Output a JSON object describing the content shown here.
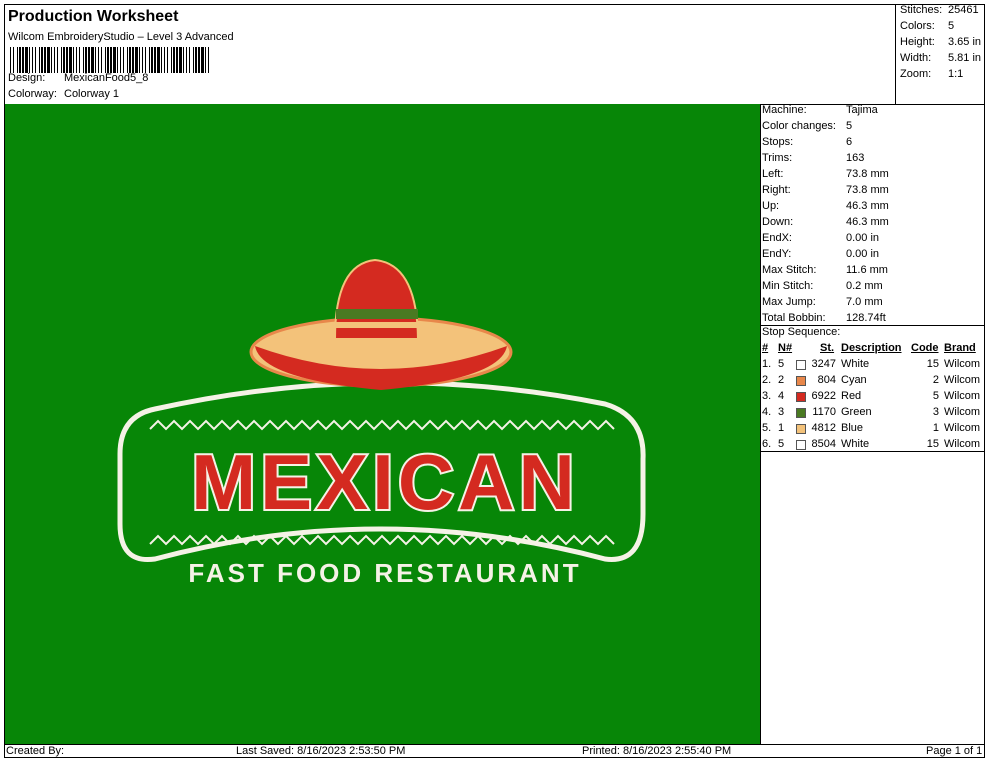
{
  "header": {
    "title": "Production Worksheet",
    "software": "Wilcom EmbroideryStudio – Level 3 Advanced",
    "design_label": "Design:",
    "design_value": "MexicanFood5_8",
    "colorway_label": "Colorway:",
    "colorway_value": "Colorway 1"
  },
  "summary": [
    {
      "label": "Stitches:",
      "value": "25461"
    },
    {
      "label": "Colors:",
      "value": "5"
    },
    {
      "label": "Height:",
      "value": "3.65 in"
    },
    {
      "label": "Width:",
      "value": "5.81 in"
    },
    {
      "label": "Zoom:",
      "value": "1:1"
    }
  ],
  "machine_info": [
    {
      "label": "Machine:",
      "value": "Tajima"
    },
    {
      "label": "Color changes:",
      "value": "5"
    },
    {
      "label": "Stops:",
      "value": "6"
    },
    {
      "label": "Trims:",
      "value": "163"
    },
    {
      "label": "Left:",
      "value": "73.8 mm"
    },
    {
      "label": "Right:",
      "value": "73.8 mm"
    },
    {
      "label": "Up:",
      "value": "46.3 mm"
    },
    {
      "label": "Down:",
      "value": "46.3 mm"
    },
    {
      "label": "EndX:",
      "value": "0.00 in"
    },
    {
      "label": "EndY:",
      "value": "0.00 in"
    },
    {
      "label": "Max Stitch:",
      "value": "11.6 mm"
    },
    {
      "label": "Min Stitch:",
      "value": "0.2 mm"
    },
    {
      "label": "Max Jump:",
      "value": "7.0 mm"
    },
    {
      "label": "Total Bobbin:",
      "value": "128.74ft"
    }
  ],
  "stop_sequence": {
    "title": "Stop Sequence:",
    "columns": [
      "#",
      "N#",
      "St.",
      "Description",
      "Code",
      "Brand"
    ],
    "rows": [
      {
        "num": "1.",
        "n": "5",
        "color": "#ffffff",
        "st": "3247",
        "desc": "White",
        "code": "15",
        "brand": "Wilcom"
      },
      {
        "num": "2.",
        "n": "2",
        "color": "#e8874a",
        "st": "804",
        "desc": "Cyan",
        "code": "2",
        "brand": "Wilcom"
      },
      {
        "num": "3.",
        "n": "4",
        "color": "#d42a20",
        "st": "6922",
        "desc": "Red",
        "code": "5",
        "brand": "Wilcom"
      },
      {
        "num": "4.",
        "n": "3",
        "color": "#4a7a22",
        "st": "1170",
        "desc": "Green",
        "code": "3",
        "brand": "Wilcom"
      },
      {
        "num": "5.",
        "n": "1",
        "color": "#f3c27a",
        "st": "4812",
        "desc": "Blue",
        "code": "1",
        "brand": "Wilcom"
      },
      {
        "num": "6.",
        "n": "5",
        "color": "#ffffff",
        "st": "8504",
        "desc": "White",
        "code": "15",
        "brand": "Wilcom"
      }
    ]
  },
  "design": {
    "main_word": "MEXICAN",
    "tagline": "FAST FOOD RESTAURANT",
    "background": "#078607"
  },
  "footer": {
    "created_by": "Created By:",
    "last_saved": "Last Saved: 8/16/2023 2:53:50 PM",
    "printed": "Printed: 8/16/2023 2:55:40 PM",
    "page": "Page 1 of 1"
  }
}
